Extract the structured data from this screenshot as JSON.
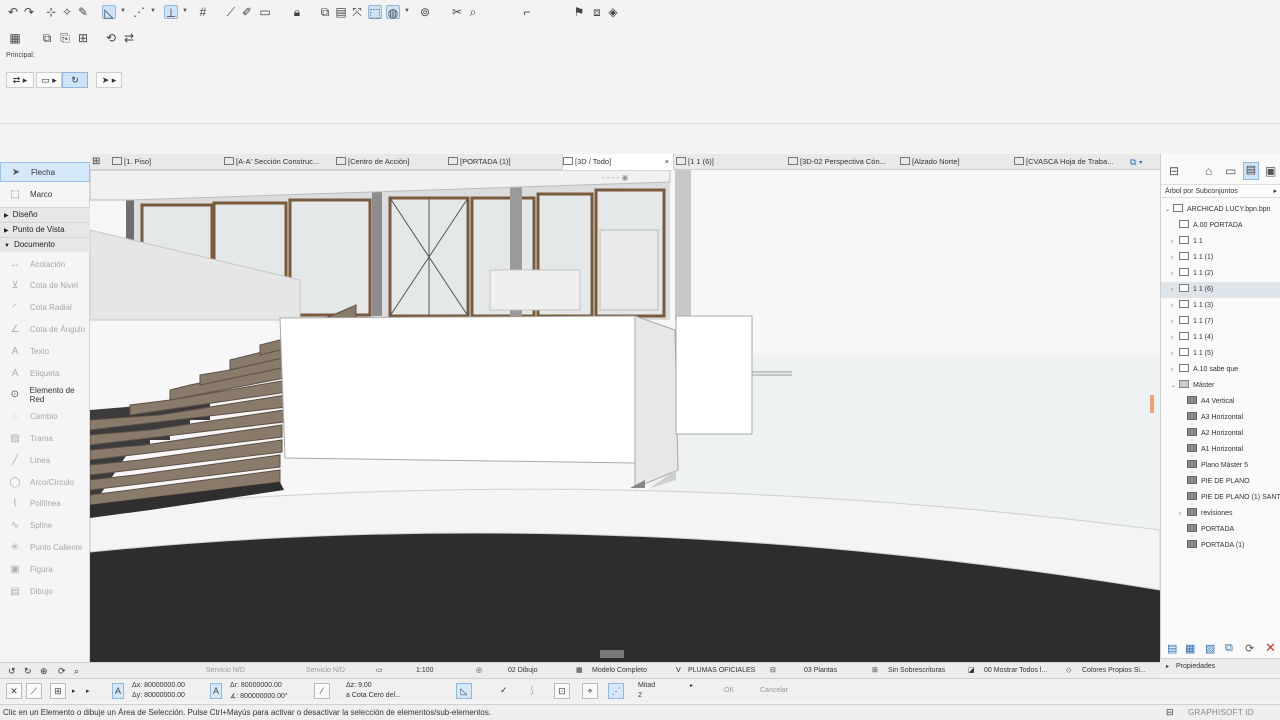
{
  "info_box": {
    "title": "Principal:"
  },
  "toolbox": {
    "tools_top": [
      {
        "label": "Flecha",
        "icon": "arrow-icon",
        "selected": true
      },
      {
        "label": "Marco",
        "icon": "marquee-icon",
        "selected": false
      }
    ],
    "sections": [
      "Diseño",
      "Punto de Vista",
      "Documento"
    ],
    "tools_doc": [
      {
        "label": "Acotación",
        "icon": "dimension-icon",
        "enabled": false
      },
      {
        "label": "Cota de Nivel",
        "icon": "level-dimension-icon",
        "enabled": false
      },
      {
        "label": "Cota Radial",
        "icon": "radial-dimension-icon",
        "enabled": false
      },
      {
        "label": "Cota de Ángulo",
        "icon": "angle-dimension-icon",
        "enabled": false
      },
      {
        "label": "Texto",
        "icon": "text-icon",
        "enabled": false
      },
      {
        "label": "Etiqueta",
        "icon": "label-icon",
        "enabled": false
      },
      {
        "label": "Elemento de Red",
        "icon": "grid-element-icon",
        "enabled": true
      },
      {
        "label": "Cambio",
        "icon": "change-icon",
        "enabled": false
      },
      {
        "label": "Trama",
        "icon": "fill-icon",
        "enabled": false
      },
      {
        "label": "Línea",
        "icon": "line-icon",
        "enabled": false
      },
      {
        "label": "Arco/Círculo",
        "icon": "arc-icon",
        "enabled": false
      },
      {
        "label": "Polilínea",
        "icon": "polyline-icon",
        "enabled": false
      },
      {
        "label": "Spline",
        "icon": "spline-icon",
        "enabled": false
      },
      {
        "label": "Punto Caliente",
        "icon": "hotspot-icon",
        "enabled": false
      },
      {
        "label": "Figura",
        "icon": "figure-icon",
        "enabled": false
      },
      {
        "label": "Dibujo",
        "icon": "drawing-icon",
        "enabled": false
      }
    ]
  },
  "tabs": [
    {
      "label": "[1. Piso]",
      "active": false
    },
    {
      "label": "[A-A' Sección Construc...",
      "active": false
    },
    {
      "label": "[Centro de Acción]",
      "active": false
    },
    {
      "label": "[PORTADA (1)]",
      "active": false
    },
    {
      "label": "[3D / Todo]",
      "active": true,
      "close": "×"
    },
    {
      "label": "[1 1 (6)]",
      "active": false
    },
    {
      "label": "[3D-02 Perspectiva Cón...",
      "active": false
    },
    {
      "label": "[Alzado Norte]",
      "active": false
    },
    {
      "label": "[CVASCA Hoja de Traba...",
      "active": false
    }
  ],
  "navigator": {
    "mode": "Árbol por Subconjuntos",
    "root": "ARCHICAD LUCY.bpn.bpn",
    "items": [
      {
        "label": "A.00 PORTADA",
        "depth": 1,
        "chevron": "",
        "icon": "file"
      },
      {
        "label": "1 1",
        "depth": 1,
        "chevron": "›",
        "icon": "file"
      },
      {
        "label": "1 1 (1)",
        "depth": 1,
        "chevron": "›",
        "icon": "file"
      },
      {
        "label": "1 1 (2)",
        "depth": 1,
        "chevron": "›",
        "icon": "file"
      },
      {
        "label": "1 1 (6)",
        "depth": 1,
        "chevron": "›",
        "icon": "file",
        "highlighted": true
      },
      {
        "label": "1 1 (3)",
        "depth": 1,
        "chevron": "›",
        "icon": "file"
      },
      {
        "label": "1 1 (7)",
        "depth": 1,
        "chevron": "›",
        "icon": "file"
      },
      {
        "label": "1 1 (4)",
        "depth": 1,
        "chevron": "›",
        "icon": "file"
      },
      {
        "label": "1 1 (5)",
        "depth": 1,
        "chevron": "›",
        "icon": "file"
      },
      {
        "label": "A.10 sabe que",
        "depth": 1,
        "chevron": "›",
        "icon": "file"
      },
      {
        "label": "Máster",
        "depth": 1,
        "chevron": "⌄",
        "icon": "folder"
      },
      {
        "label": "A4 Vertical",
        "depth": 2,
        "chevron": "",
        "icon": "filled"
      },
      {
        "label": "A3 Horizontal",
        "depth": 2,
        "chevron": "",
        "icon": "filled"
      },
      {
        "label": "A2 Horizontal",
        "depth": 2,
        "chevron": "",
        "icon": "filled"
      },
      {
        "label": "A1 Horizontal",
        "depth": 2,
        "chevron": "",
        "icon": "filled"
      },
      {
        "label": "Plano Máster 5",
        "depth": 2,
        "chevron": "",
        "icon": "filled"
      },
      {
        "label": "PIE DE PLANO",
        "depth": 2,
        "chevron": "",
        "icon": "filled"
      },
      {
        "label": "PIE DE PLANO (1) SANTI",
        "depth": 2,
        "chevron": "",
        "icon": "filled"
      },
      {
        "label": "revisiones",
        "depth": 2,
        "chevron": "›",
        "icon": "filled"
      },
      {
        "label": "PORTADA",
        "depth": 2,
        "chevron": "",
        "icon": "filled"
      },
      {
        "label": "PORTADA (1)",
        "depth": 2,
        "chevron": "",
        "icon": "filled"
      }
    ],
    "properties_label": "Propiedades"
  },
  "viewbar": {
    "servicio1": "Servicio N/D",
    "servicio2": "Servicio N/D",
    "scale": "1:100",
    "layer": "02 Dibujo",
    "model": "Modelo Completo",
    "pens": "PLUMAS OFICIALES",
    "plants": "03 Plantas",
    "overrides": "Sin Sobrescrituras",
    "show": "00 Mostrar Todos l...",
    "colors": "Colores Propios Si..."
  },
  "coordbar": {
    "ax": "Δx: 80000000.00",
    "ay": "Δy: 80000000.00",
    "ar": "Δr: 80000000.00",
    "aangle": "∡: 800000000.00°",
    "az": "Δz: 9.00",
    "az_ref": "a Cota Cero del...",
    "mitad": "Mitad",
    "mitad_n": "2",
    "ok": "OK",
    "cancel": "Cancelar"
  },
  "status": {
    "message": "Clic en un Elemento o dibuje un Área de Selección. Pulse Ctrl+Mayús para activar o desactivar la selección de elementos/sub-elementos.",
    "brand": "GRAPHISOFT ID"
  }
}
